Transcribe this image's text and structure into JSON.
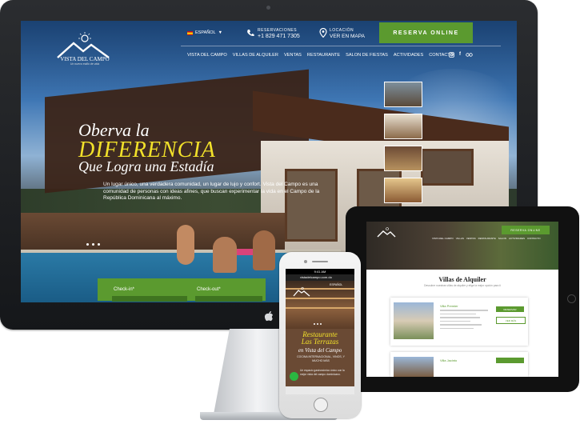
{
  "desktop": {
    "brand": {
      "name": "VISTA DEL CAMPO",
      "tagline": "Un nuevo estilo de vida"
    },
    "language": "ESPAÑOL",
    "reservations": {
      "label": "RESERVACIONES",
      "phone": "+1 829 471 7305"
    },
    "location": {
      "label": "LOCACIÓN",
      "link": "VER EN MAPA"
    },
    "cta": "RESERVA ONLINE",
    "nav": [
      "VISTA DEL CAMPO",
      "VILLAS DE ALQUILER",
      "VENTAS",
      "RESTAURANTE",
      "SALON DE FIESTAS",
      "ACTIVIDADES",
      "CONTACTO"
    ],
    "social": [
      "instagram-icon",
      "facebook-icon",
      "tripadvisor-icon"
    ],
    "hero": {
      "line1": "Oberva la",
      "line2": "DIFERENCIA",
      "line3": "Que Logra una Estadía",
      "paragraph": "Un lugar único, una verdadera comunidad, un lugar de lujo y confort. Vista del Campo es una comunidad de personas con ideas afines, que buscan experimentar la vida en el Campo de la República Dominicana al máximo."
    },
    "booking": {
      "checkin": "Check-in*",
      "checkout": "Check-out*"
    }
  },
  "tablet": {
    "cta": "RESERVA ONLINE",
    "nav": [
      "VISTA DEL CAMPO",
      "VILLAS",
      "VENTAS",
      "RESTAURANTE",
      "SALON",
      "ACTIVIDADES",
      "CONTACTO"
    ],
    "section_title": "Villas de Alquiler",
    "section_sub": "Descubre nuestras villas de alquiler y elige la mejor opción para ti",
    "cards": [
      {
        "title": "Villa Premier",
        "btn1": "RESERVAR",
        "btn2": "VER MÁS"
      },
      {
        "title": "Villa Jacinto",
        "btn1": "RESERVAR"
      }
    ]
  },
  "phone": {
    "time": "9:41 AM",
    "url": "vistadelcampo.com.do",
    "language": "ESPAÑOL",
    "hero": {
      "line1": "Restaurante",
      "line2": "Las Terrazas",
      "line3": "en Vista del Campo",
      "text": "COCINA INTERNACIONAL, VINOS, Y MUCHO MÁS",
      "paragraph": "Un espacio gastronómico único con la mejor vista del campo dominicano."
    }
  },
  "colors": {
    "accent": "#5b9a2f",
    "headline_yellow": "#f2e12a"
  }
}
